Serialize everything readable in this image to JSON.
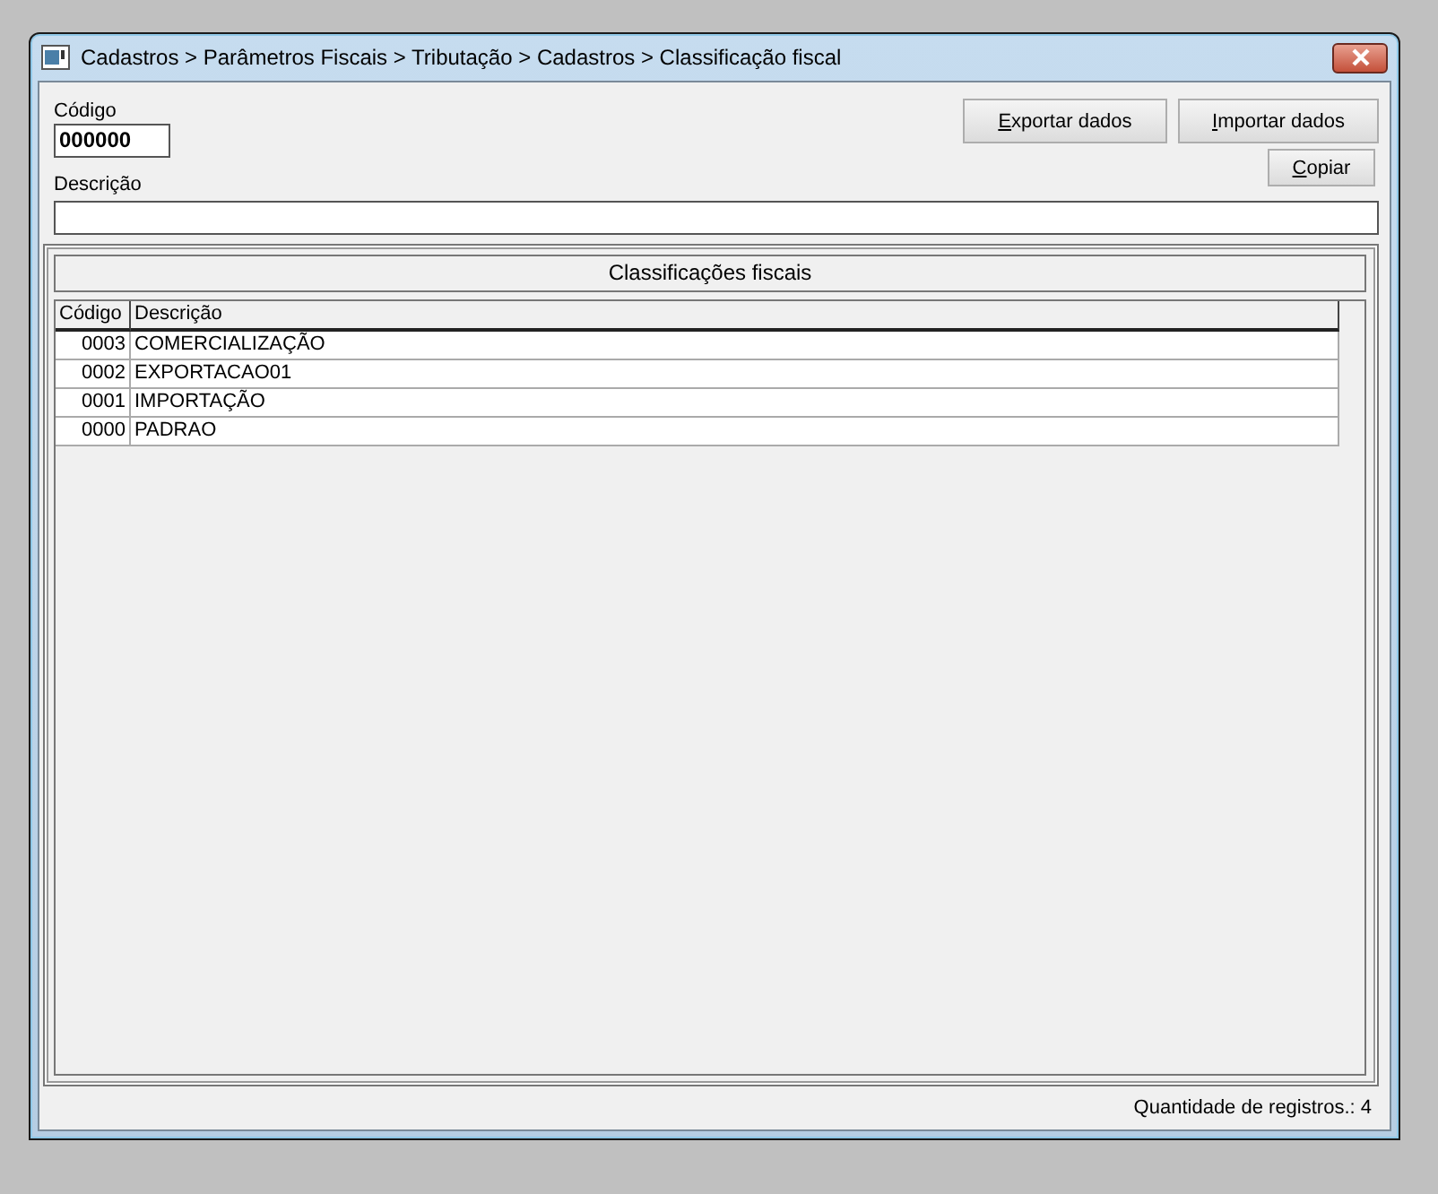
{
  "window": {
    "title": "Cadastros > Parâmetros Fiscais > Tributação > Cadastros > Classificação fiscal"
  },
  "form": {
    "code_label": "Código",
    "code_value": "000000",
    "description_label": "Descrição"
  },
  "buttons": [
    {
      "label": "Exportar dados",
      "first_letter_underlined": true
    },
    {
      "label": "Importar dados",
      "first_letter_underlined": true
    },
    {
      "label": "Copiar",
      "first_letter_underlined": true
    }
  ],
  "group": {
    "title": "Classificações fiscais"
  },
  "table": {
    "columns": [
      "Código",
      "Descrição"
    ],
    "rows": [
      {
        "cells": [
          "0003",
          "COMERCIALIZAÇÃO"
        ]
      },
      {
        "cells": [
          "0002",
          "EXPORTACAO01"
        ]
      },
      {
        "cells": [
          "0001",
          "IMPORTAÇÃO"
        ]
      },
      {
        "cells": [
          "0000",
          "PADRAO"
        ]
      }
    ]
  },
  "status_bar": {
    "text": "Quantidade de registros.: 4"
  }
}
